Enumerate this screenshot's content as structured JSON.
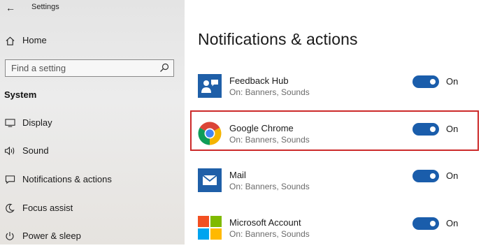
{
  "window": {
    "title": "Settings",
    "back_icon": "back-arrow-icon"
  },
  "sidebar": {
    "home_label": "Home",
    "search": {
      "placeholder": "Find a setting"
    },
    "section_header": "System",
    "items": [
      {
        "label": "Display",
        "icon": "display-icon"
      },
      {
        "label": "Sound",
        "icon": "sound-icon"
      },
      {
        "label": "Notifications & actions",
        "icon": "notifications-icon"
      },
      {
        "label": "Focus assist",
        "icon": "focus-assist-icon"
      },
      {
        "label": "Power & sleep",
        "icon": "power-icon"
      }
    ]
  },
  "main": {
    "title": "Notifications & actions",
    "apps": [
      {
        "name": "Feedback Hub",
        "status": "On: Banners, Sounds",
        "toggle_label": "On",
        "toggle_on": true,
        "icon": "feedback-hub-icon",
        "icon_bg": "#1f5fa8"
      },
      {
        "name": "Google Chrome",
        "status": "On: Banners, Sounds",
        "toggle_label": "On",
        "toggle_on": true,
        "icon": "chrome-icon",
        "highlighted": true
      },
      {
        "name": "Mail",
        "status": "On: Banners, Sounds",
        "toggle_label": "On",
        "toggle_on": true,
        "icon": "mail-icon",
        "icon_bg": "#1f5fa8"
      },
      {
        "name": "Microsoft Account",
        "status": "On: Banners, Sounds",
        "toggle_label": "On",
        "toggle_on": true,
        "icon": "microsoft-logo-icon"
      }
    ]
  },
  "colors": {
    "toggle_on": "#1a5dab",
    "highlight_border": "#cc2a2a",
    "sidebar_bg": "#e8e8e8",
    "secondary_text": "#6b6b6b"
  }
}
